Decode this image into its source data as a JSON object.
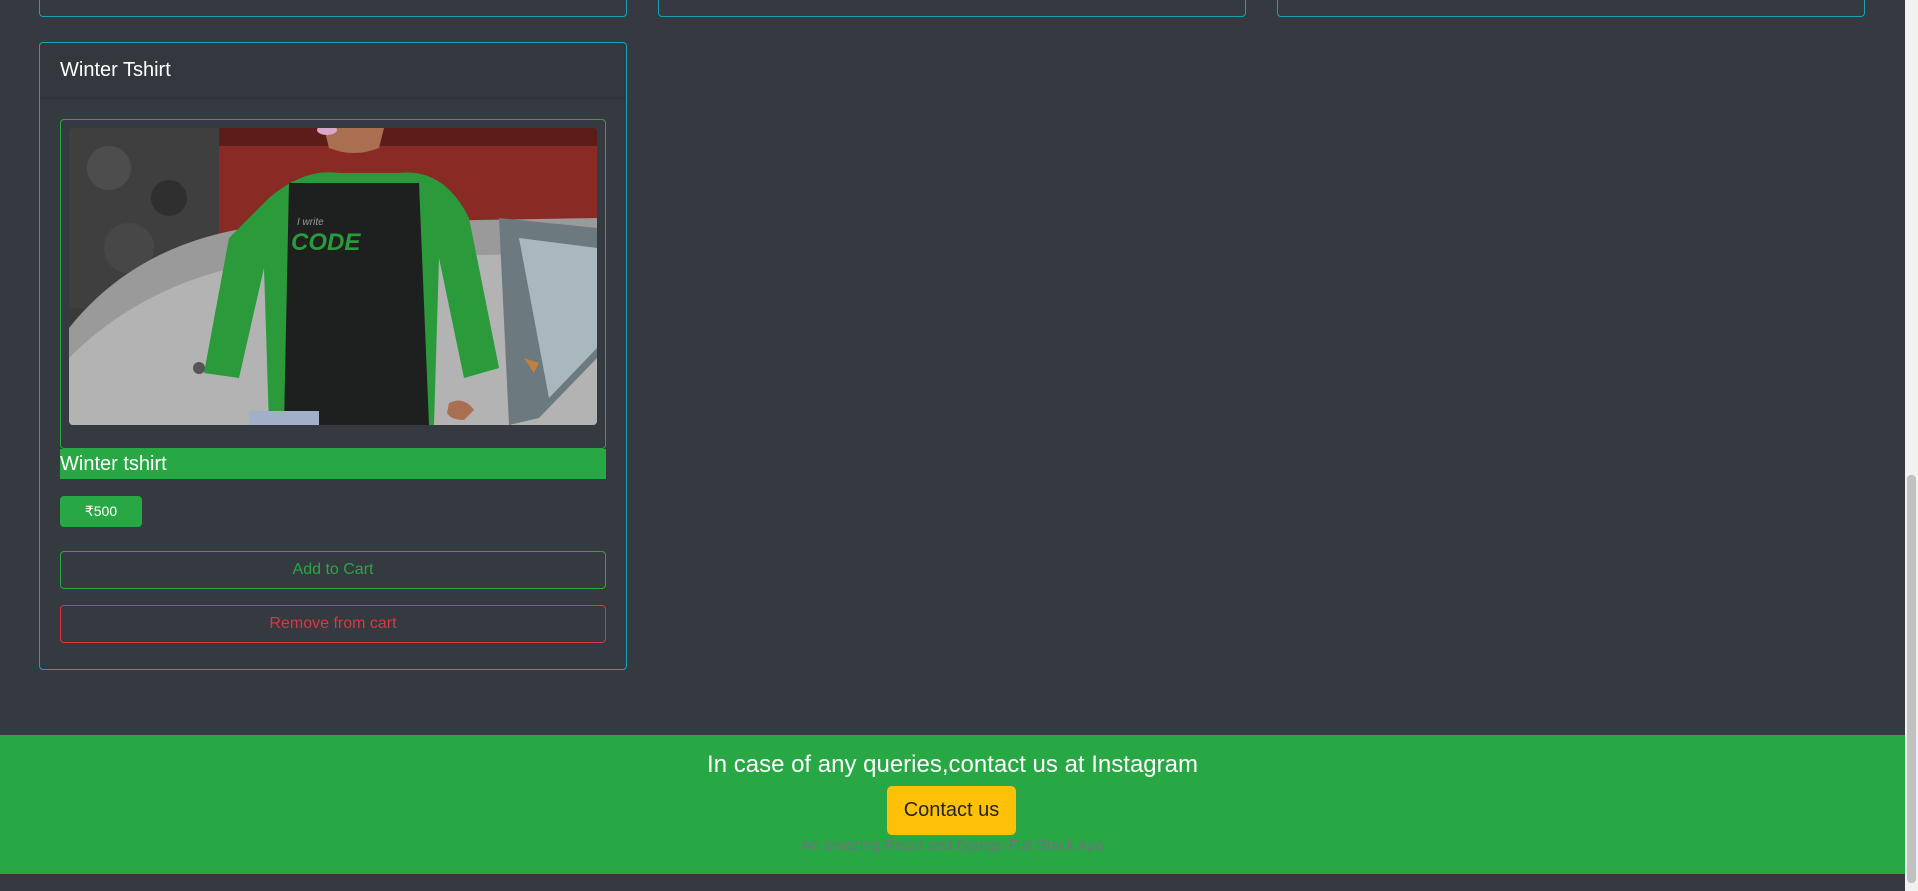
{
  "product": {
    "header_title": "Winter Tshirt",
    "name": "Winter tshirt",
    "price": "₹500",
    "image_text_small": "I write",
    "image_text_big": "CODE",
    "add_label": "Add to Cart",
    "remove_label": "Remove from cart"
  },
  "footer": {
    "text": "In case of any queries,contact us at Instagram",
    "contact_label": "Contact us",
    "subtext": "An amazing React and Django Full Stack App"
  },
  "colors": {
    "background": "#343a40",
    "card_border": "#17a2b8",
    "success": "#28a745",
    "danger": "#dc3545",
    "warning": "#ffc107"
  }
}
